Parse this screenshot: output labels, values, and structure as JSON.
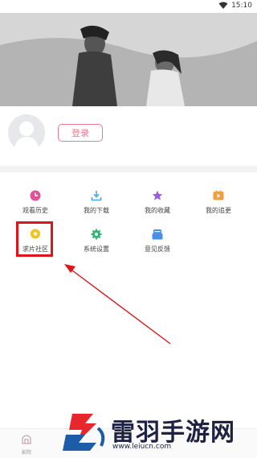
{
  "status_bar": {
    "time": "15:10",
    "icons": [
      "wifi-icon"
    ]
  },
  "profile": {
    "login_label": "登录",
    "avatar_icon": "user-avatar-icon"
  },
  "menu": {
    "items": [
      {
        "label": "观看历史",
        "icon": "clock-icon",
        "color": "#e0529a"
      },
      {
        "label": "我的下载",
        "icon": "download-icon",
        "color": "#4aa8e8"
      },
      {
        "label": "我的收藏",
        "icon": "star-icon",
        "color": "#9b5de5"
      },
      {
        "label": "我的追更",
        "icon": "play-icon",
        "color": "#f39c3c"
      },
      {
        "label": "求片社区",
        "icon": "chat-icon",
        "color": "#f2c318"
      },
      {
        "label": "系统设置",
        "icon": "gear-icon",
        "color": "#2bb673"
      },
      {
        "label": "意见反馈",
        "icon": "feedback-icon",
        "color": "#4a90e2"
      }
    ]
  },
  "annotation": {
    "highlight_color": "#e0131a",
    "arrow_color": "#e0131a"
  },
  "bottom_nav": {
    "items": [
      {
        "label": "影院",
        "icon": "cinema-icon"
      }
    ]
  },
  "watermark": {
    "title": "雷羽手游网",
    "url": "www.leiucn.com"
  },
  "colors": {
    "accent": "#f07a93",
    "divider": "#f3f3f3"
  }
}
